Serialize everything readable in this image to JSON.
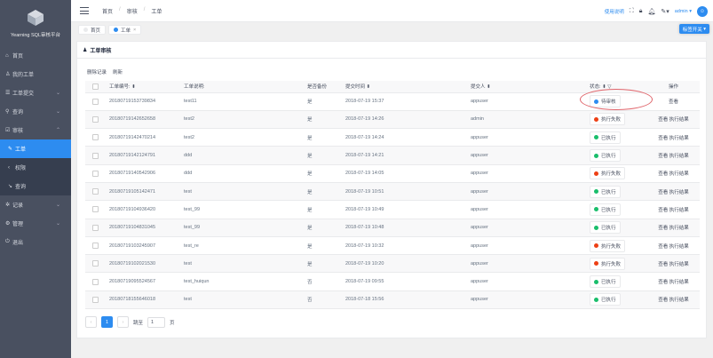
{
  "app": {
    "logo_text": "Yearning SQL审核平台"
  },
  "sidebar": {
    "items": [
      {
        "icon": "home-icon",
        "label": "首页"
      },
      {
        "icon": "user-icon",
        "label": "我的工单"
      },
      {
        "icon": "upload-icon",
        "label": "工单提交"
      },
      {
        "icon": "search-icon",
        "label": "查询"
      },
      {
        "icon": "audit-icon",
        "label": "审核"
      },
      {
        "icon": "edit-icon",
        "label": "工单"
      },
      {
        "icon": "share-icon",
        "label": "权限"
      },
      {
        "icon": "query-icon",
        "label": "查询"
      },
      {
        "icon": "settings-icon",
        "label": "记录"
      },
      {
        "icon": "cog-icon",
        "label": "管理"
      },
      {
        "icon": "power-icon",
        "label": "退出"
      }
    ]
  },
  "header": {
    "breadcrumb": [
      "首页",
      "审核",
      "工单"
    ],
    "help_link": "使用说明",
    "user": "admin"
  },
  "tags": {
    "home": "首页",
    "current": "工单",
    "close_button": "标签开关"
  },
  "card": {
    "title": "工单审核",
    "delete_label": "删除记录",
    "refresh_label": "刷新"
  },
  "table": {
    "columns": [
      "工单编号:",
      "工单说明:",
      "是否备份",
      "提交时间",
      "提交人",
      "状态:",
      "操作"
    ],
    "rows": [
      {
        "id": "20180719153739834",
        "desc": "test11",
        "backup": "是",
        "time": "2018-07-19 15:37",
        "user": "appuser",
        "status": "待审核",
        "status_color": "#2d8cf0",
        "ops": [
          "查看"
        ]
      },
      {
        "id": "20180719142652658",
        "desc": "test2",
        "backup": "是",
        "time": "2018-07-19 14:26",
        "user": "admin",
        "status": "执行失败",
        "status_color": "#ed3f14",
        "ops": [
          "查看",
          "执行结果"
        ]
      },
      {
        "id": "20180719142470214",
        "desc": "test2",
        "backup": "是",
        "time": "2018-07-19 14:24",
        "user": "appuser",
        "status": "已执行",
        "status_color": "#19be6b",
        "ops": [
          "查看",
          "执行结果"
        ]
      },
      {
        "id": "20180719142124791",
        "desc": "ddd",
        "backup": "是",
        "time": "2018-07-19 14:21",
        "user": "appuser",
        "status": "已执行",
        "status_color": "#19be6b",
        "ops": [
          "查看",
          "执行结果"
        ]
      },
      {
        "id": "20180719140542906",
        "desc": "ddd",
        "backup": "是",
        "time": "2018-07-19 14:05",
        "user": "appuser",
        "status": "执行失败",
        "status_color": "#ed3f14",
        "ops": [
          "查看",
          "执行结果"
        ]
      },
      {
        "id": "20180719105142471",
        "desc": "test",
        "backup": "是",
        "time": "2018-07-19 10:51",
        "user": "appuser",
        "status": "已执行",
        "status_color": "#19be6b",
        "ops": [
          "查看",
          "执行结果"
        ]
      },
      {
        "id": "20180719104936420",
        "desc": "test_99",
        "backup": "是",
        "time": "2018-07-19 10:49",
        "user": "appuser",
        "status": "已执行",
        "status_color": "#19be6b",
        "ops": [
          "查看",
          "执行结果"
        ]
      },
      {
        "id": "20180719104831045",
        "desc": "test_99",
        "backup": "是",
        "time": "2018-07-19 10:48",
        "user": "appuser",
        "status": "已执行",
        "status_color": "#19be6b",
        "ops": [
          "查看",
          "执行结果"
        ]
      },
      {
        "id": "20180719103245907",
        "desc": "test_re",
        "backup": "是",
        "time": "2018-07-19 10:32",
        "user": "appuser",
        "status": "执行失败",
        "status_color": "#ed3f14",
        "ops": [
          "查看",
          "执行结果"
        ]
      },
      {
        "id": "20180719102021530",
        "desc": "test",
        "backup": "是",
        "time": "2018-07-19 10:20",
        "user": "appuser",
        "status": "执行失败",
        "status_color": "#ed3f14",
        "ops": [
          "查看",
          "执行结果"
        ]
      },
      {
        "id": "20180719095524567",
        "desc": "test_huiqun",
        "backup": "否",
        "time": "2018-07-19 09:55",
        "user": "appuser",
        "status": "已执行",
        "status_color": "#19be6b",
        "ops": [
          "查看",
          "执行结果"
        ]
      },
      {
        "id": "20180718155646018",
        "desc": "test",
        "backup": "否",
        "time": "2018-07-18 15:56",
        "user": "appuser",
        "status": "已执行",
        "status_color": "#19be6b",
        "ops": [
          "查看",
          "执行结果"
        ]
      }
    ]
  },
  "pager": {
    "prev": "‹",
    "current": "1",
    "next": "›",
    "jump_label": "跳至",
    "jump_value": "1",
    "page_suffix": "页"
  }
}
